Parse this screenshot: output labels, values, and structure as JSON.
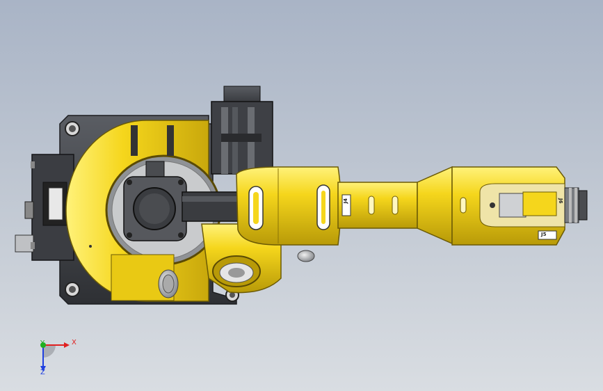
{
  "viewport": {
    "background_top": "#a9b4c6",
    "background_bottom": "#d9dde2"
  },
  "colors": {
    "robot_yellow": "#f2d41a",
    "robot_yellow_dark": "#b89a08",
    "base_plate": "#4a4d52",
    "base_plate_dark": "#2e3034",
    "motor_dark": "#3a3c40",
    "axis_x": "#e02020",
    "axis_y": "#20b020",
    "axis_z": "#2040e0"
  },
  "labels": {
    "joint_j4": "J4",
    "joint_j5": "J5",
    "joint_j6": "J6"
  },
  "triad": {
    "x_label": "X",
    "y_label": "Y",
    "z_label": "Z"
  },
  "icons": {
    "triad": "coordinate-triad-icon"
  }
}
